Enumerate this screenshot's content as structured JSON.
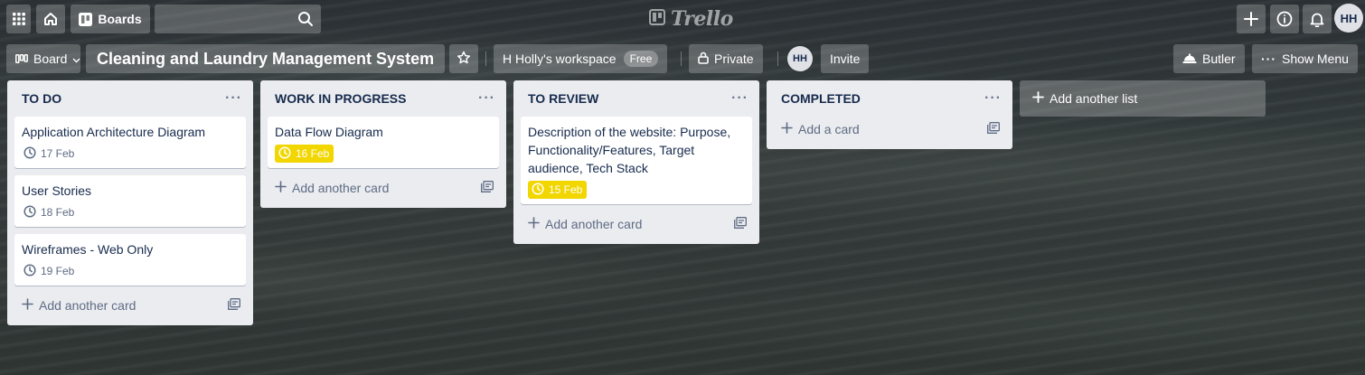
{
  "header": {
    "boards_label": "Boards",
    "search": {
      "value": "",
      "placeholder": ""
    },
    "logo_text": "Trello",
    "avatar_initials": "HH"
  },
  "board": {
    "view_label": "Board",
    "title": "Cleaning and Laundry Management System",
    "workspace_label": "H Holly's workspace",
    "workspace_badge": "Free",
    "visibility_label": "Private",
    "member_initials": "HH",
    "invite_label": "Invite",
    "butler_label": "Butler",
    "show_menu_label": "Show Menu"
  },
  "lists": [
    {
      "title": "TO DO",
      "menu": "···",
      "cards": [
        {
          "title": "Application Architecture Diagram",
          "due": "17 Feb",
          "due_status": "normal"
        },
        {
          "title": "User Stories",
          "due": "18 Feb",
          "due_status": "normal"
        },
        {
          "title": "Wireframes - Web Only",
          "due": "19 Feb",
          "due_status": "normal"
        }
      ],
      "composer_label": "Add another card"
    },
    {
      "title": "WORK IN PROGRESS",
      "menu": "···",
      "cards": [
        {
          "title": "Data Flow Diagram",
          "due": "16 Feb",
          "due_status": "due-soon"
        }
      ],
      "composer_label": "Add another card"
    },
    {
      "title": "TO REVIEW",
      "menu": "···",
      "cards": [
        {
          "title": "Description of the website: Purpose, Functionality/Features, Target audience, Tech Stack",
          "due": "15 Feb",
          "due_status": "due-soon"
        }
      ],
      "composer_label": "Add another card"
    },
    {
      "title": "COMPLETED",
      "menu": "···",
      "cards": [],
      "composer_label": "Add a card"
    }
  ],
  "add_list_label": "Add another list",
  "colors": {
    "due_soon": "#f2d600",
    "list_bg": "#ebecf0",
    "text_primary": "#172b4d",
    "text_subtle": "#5e6c84"
  }
}
